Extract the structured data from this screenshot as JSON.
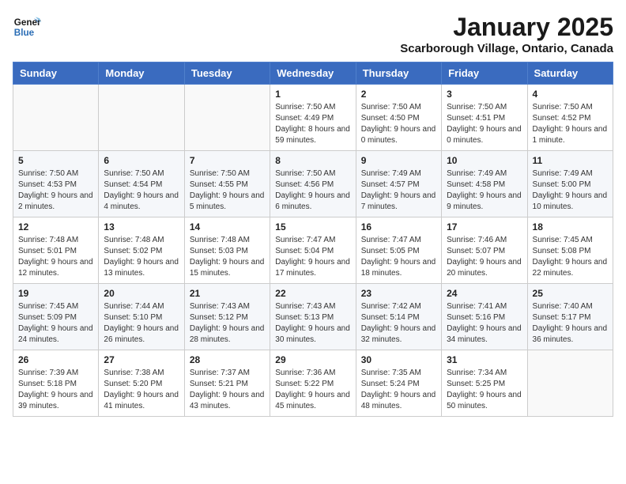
{
  "header": {
    "logo_line1": "General",
    "logo_line2": "Blue",
    "month_title": "January 2025",
    "location": "Scarborough Village, Ontario, Canada"
  },
  "weekdays": [
    "Sunday",
    "Monday",
    "Tuesday",
    "Wednesday",
    "Thursday",
    "Friday",
    "Saturday"
  ],
  "weeks": [
    [
      {
        "day": "",
        "info": ""
      },
      {
        "day": "",
        "info": ""
      },
      {
        "day": "",
        "info": ""
      },
      {
        "day": "1",
        "info": "Sunrise: 7:50 AM\nSunset: 4:49 PM\nDaylight: 8 hours and 59 minutes."
      },
      {
        "day": "2",
        "info": "Sunrise: 7:50 AM\nSunset: 4:50 PM\nDaylight: 9 hours and 0 minutes."
      },
      {
        "day": "3",
        "info": "Sunrise: 7:50 AM\nSunset: 4:51 PM\nDaylight: 9 hours and 0 minutes."
      },
      {
        "day": "4",
        "info": "Sunrise: 7:50 AM\nSunset: 4:52 PM\nDaylight: 9 hours and 1 minute."
      }
    ],
    [
      {
        "day": "5",
        "info": "Sunrise: 7:50 AM\nSunset: 4:53 PM\nDaylight: 9 hours and 2 minutes."
      },
      {
        "day": "6",
        "info": "Sunrise: 7:50 AM\nSunset: 4:54 PM\nDaylight: 9 hours and 4 minutes."
      },
      {
        "day": "7",
        "info": "Sunrise: 7:50 AM\nSunset: 4:55 PM\nDaylight: 9 hours and 5 minutes."
      },
      {
        "day": "8",
        "info": "Sunrise: 7:50 AM\nSunset: 4:56 PM\nDaylight: 9 hours and 6 minutes."
      },
      {
        "day": "9",
        "info": "Sunrise: 7:49 AM\nSunset: 4:57 PM\nDaylight: 9 hours and 7 minutes."
      },
      {
        "day": "10",
        "info": "Sunrise: 7:49 AM\nSunset: 4:58 PM\nDaylight: 9 hours and 9 minutes."
      },
      {
        "day": "11",
        "info": "Sunrise: 7:49 AM\nSunset: 5:00 PM\nDaylight: 9 hours and 10 minutes."
      }
    ],
    [
      {
        "day": "12",
        "info": "Sunrise: 7:48 AM\nSunset: 5:01 PM\nDaylight: 9 hours and 12 minutes."
      },
      {
        "day": "13",
        "info": "Sunrise: 7:48 AM\nSunset: 5:02 PM\nDaylight: 9 hours and 13 minutes."
      },
      {
        "day": "14",
        "info": "Sunrise: 7:48 AM\nSunset: 5:03 PM\nDaylight: 9 hours and 15 minutes."
      },
      {
        "day": "15",
        "info": "Sunrise: 7:47 AM\nSunset: 5:04 PM\nDaylight: 9 hours and 17 minutes."
      },
      {
        "day": "16",
        "info": "Sunrise: 7:47 AM\nSunset: 5:05 PM\nDaylight: 9 hours and 18 minutes."
      },
      {
        "day": "17",
        "info": "Sunrise: 7:46 AM\nSunset: 5:07 PM\nDaylight: 9 hours and 20 minutes."
      },
      {
        "day": "18",
        "info": "Sunrise: 7:45 AM\nSunset: 5:08 PM\nDaylight: 9 hours and 22 minutes."
      }
    ],
    [
      {
        "day": "19",
        "info": "Sunrise: 7:45 AM\nSunset: 5:09 PM\nDaylight: 9 hours and 24 minutes."
      },
      {
        "day": "20",
        "info": "Sunrise: 7:44 AM\nSunset: 5:10 PM\nDaylight: 9 hours and 26 minutes."
      },
      {
        "day": "21",
        "info": "Sunrise: 7:43 AM\nSunset: 5:12 PM\nDaylight: 9 hours and 28 minutes."
      },
      {
        "day": "22",
        "info": "Sunrise: 7:43 AM\nSunset: 5:13 PM\nDaylight: 9 hours and 30 minutes."
      },
      {
        "day": "23",
        "info": "Sunrise: 7:42 AM\nSunset: 5:14 PM\nDaylight: 9 hours and 32 minutes."
      },
      {
        "day": "24",
        "info": "Sunrise: 7:41 AM\nSunset: 5:16 PM\nDaylight: 9 hours and 34 minutes."
      },
      {
        "day": "25",
        "info": "Sunrise: 7:40 AM\nSunset: 5:17 PM\nDaylight: 9 hours and 36 minutes."
      }
    ],
    [
      {
        "day": "26",
        "info": "Sunrise: 7:39 AM\nSunset: 5:18 PM\nDaylight: 9 hours and 39 minutes."
      },
      {
        "day": "27",
        "info": "Sunrise: 7:38 AM\nSunset: 5:20 PM\nDaylight: 9 hours and 41 minutes."
      },
      {
        "day": "28",
        "info": "Sunrise: 7:37 AM\nSunset: 5:21 PM\nDaylight: 9 hours and 43 minutes."
      },
      {
        "day": "29",
        "info": "Sunrise: 7:36 AM\nSunset: 5:22 PM\nDaylight: 9 hours and 45 minutes."
      },
      {
        "day": "30",
        "info": "Sunrise: 7:35 AM\nSunset: 5:24 PM\nDaylight: 9 hours and 48 minutes."
      },
      {
        "day": "31",
        "info": "Sunrise: 7:34 AM\nSunset: 5:25 PM\nDaylight: 9 hours and 50 minutes."
      },
      {
        "day": "",
        "info": ""
      }
    ]
  ]
}
